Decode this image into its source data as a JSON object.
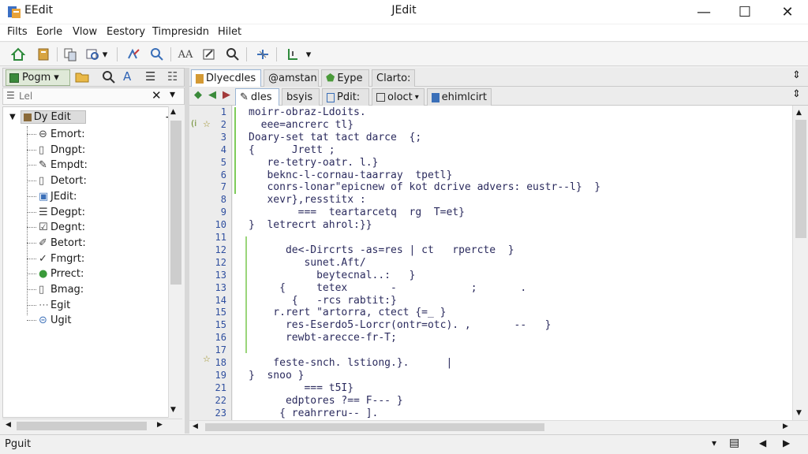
{
  "window": {
    "app_name": "EEdit",
    "title": "JEdit",
    "controls": [
      "—",
      "☐",
      "✕"
    ]
  },
  "menu": [
    "Filts",
    "Eorle",
    "Vlow",
    "Eestory",
    "Timpresidn",
    "Hilet"
  ],
  "left_panel": {
    "dropdown": "Pogm",
    "filter_placeholder": "Lel",
    "root": "Dy Edit",
    "items": [
      {
        "label": "Emort:",
        "icon": "link-icon"
      },
      {
        "label": "Dngpt:",
        "icon": "document-icon"
      },
      {
        "label": "Empdt:",
        "icon": "edit-icon"
      },
      {
        "label": "Detort:",
        "icon": "document-icon"
      },
      {
        "label": "JEdit:",
        "icon": "jedit-icon"
      },
      {
        "label": "Degpt:",
        "icon": "list-icon"
      },
      {
        "label": "Degnt:",
        "icon": "checkbox-icon"
      },
      {
        "label": "Betort:",
        "icon": "pencil-icon"
      },
      {
        "label": "Fmgrt:",
        "icon": "check-edit-icon"
      },
      {
        "label": "Prrect:",
        "icon": "green-circle-icon"
      },
      {
        "label": "Bmag:",
        "icon": "document-icon"
      },
      {
        "label": "Egit",
        "icon": "dotted-icon"
      },
      {
        "label": "Ugit",
        "icon": "globe-icon"
      }
    ]
  },
  "editor_tabs": {
    "row1": [
      "Dlyecdles",
      "@amstan",
      "Eype",
      "Clarto:"
    ],
    "row2": [
      "dles",
      "bsyis",
      "Pdit:",
      "oloct",
      "ehimlcirt"
    ]
  },
  "editor": {
    "lines": [
      {
        "n": "1",
        "text": "moirr-obraz-Ldoits."
      },
      {
        "n": "2",
        "text": "  eee=ancrerc tl}"
      },
      {
        "n": "3",
        "text": "Doary-set tat tact darce  {;"
      },
      {
        "n": "4",
        "text": "{      Jrett ;"
      },
      {
        "n": "5",
        "text": "   re-tetry-oatr. l.}"
      },
      {
        "n": "6",
        "text": "   beknc-l-cornau-taarray  tpetl}"
      },
      {
        "n": "7",
        "text": "   conrs-lonar\"epicnew of kot dcrive advers: eustr--l}  }"
      },
      {
        "n": "8",
        "text": "   xevr},resstitx :"
      },
      {
        "n": "9",
        "text": "        ===  teartarcetq  rg  T=et}"
      },
      {
        "n": "10",
        "text": "}  letrecrt ahrol:}}"
      },
      {
        "n": "11",
        "text": ""
      },
      {
        "n": "12",
        "text": "      de<-Dircrts -as=res | ct   rpercte  }"
      },
      {
        "n": "12",
        "text": "         sunet.Aft/"
      },
      {
        "n": "13",
        "text": "           beytecnal..:   }"
      },
      {
        "n": "13",
        "text": "     {     tetex       -            ;       ."
      },
      {
        "n": "14",
        "text": "       {   -rcs rabtit:}"
      },
      {
        "n": "15",
        "text": "    r.rert \"artorra, ctect {=_ }"
      },
      {
        "n": "15",
        "text": "      res-Eserdo5-Lorcr(ontr=otc). ,       --   }"
      },
      {
        "n": "16",
        "text": "      rewbt-arecce-fr-T;"
      },
      {
        "n": "17",
        "text": ""
      },
      {
        "n": "18",
        "text": "    feste-snch. lstiong.}.      |"
      },
      {
        "n": "19",
        "text": "}  snoo }"
      },
      {
        "n": "21",
        "text": "         === t5I}"
      },
      {
        "n": "22",
        "text": "      edptores ?== F--- }"
      },
      {
        "n": "23",
        "text": "     { reahrreru-- ]."
      }
    ]
  },
  "status": {
    "left": "Pguit"
  }
}
